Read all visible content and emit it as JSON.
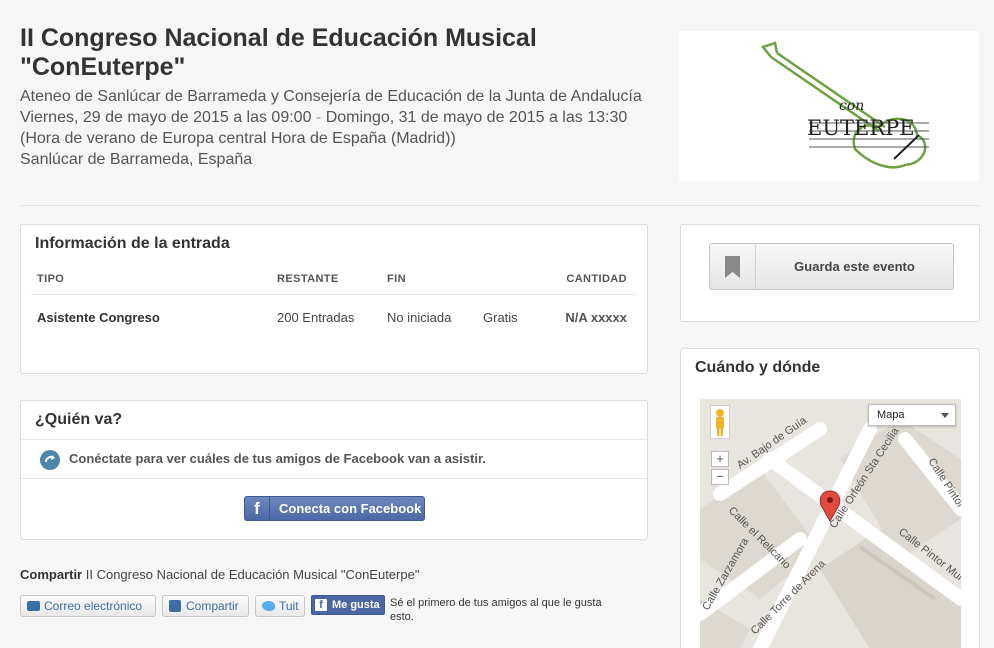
{
  "event": {
    "title": "II Congreso Nacional de Educación Musical \"ConEuterpe\"",
    "organizer": "Ateneo de Sanlúcar de Barrameda y Consejería de Educación de la Junta de Andalucía",
    "date_start": "Viernes, 29 de mayo de 2015 a las 09:00",
    "date_separator": "-",
    "date_end": "Domingo, 31 de mayo de 2015 a las 13:30",
    "timezone": "(Hora de verano de Europa central Hora de España (Madrid))",
    "location": "Sanlúcar de Barrameda, España"
  },
  "logo": {
    "word_prefix": "con",
    "word_main": "EUTERPE"
  },
  "tickets": {
    "heading": "Información de la entrada",
    "columns": [
      "TIPO",
      "RESTANTE",
      "FIN",
      "CANTIDAD"
    ],
    "rows": [
      {
        "type": "Asistente Congreso",
        "remaining": "200 Entradas",
        "end": "No iniciada",
        "price": "Gratis",
        "quantity": "N/A xxxxx"
      }
    ]
  },
  "who": {
    "heading": "¿Quién va?",
    "connect_text": "Conéctate para ver cuáles de tus amigos de Facebook van a asistir.",
    "facebook_button": "Conecta con Facebook",
    "facebook_glyph": "f"
  },
  "share": {
    "label": "Compartir",
    "event_name": "II Congreso Nacional de Educación Musical \"ConEuterpe\"",
    "email_button": "Correo electrónico",
    "linkedin_button": "Compartir",
    "twitter_button": "Tuit",
    "like_button": "Me gusta",
    "like_text": "Sé el primero de tus amigos al que le gusta esto."
  },
  "save": {
    "button_label": "Guarda este evento"
  },
  "where": {
    "heading": "Cuándo y dónde",
    "map_type": "Mapa",
    "zoom_in": "+",
    "zoom_out": "−",
    "streets": [
      "Av. Bajo de Guía",
      "Calle Orfeón Sta Cecilia",
      "Calle Pintor",
      "Calle el Relicario",
      "Calle Pintor Muri",
      "Calle Zarzamora",
      "Calle Torre de Arena"
    ]
  },
  "colors": {
    "facebook_blue": "#4c66a4",
    "link_blue": "#3b6ea5",
    "map_marker": "#e04a3f",
    "logo_green": "#6ea140"
  }
}
